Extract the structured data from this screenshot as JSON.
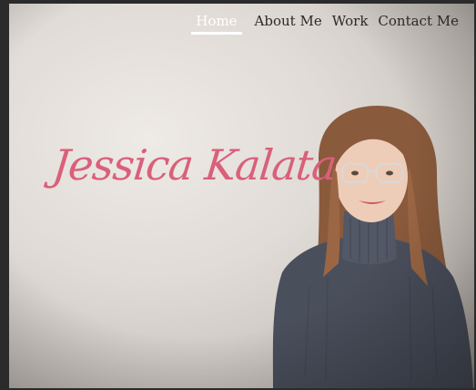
{
  "nav": {
    "items": [
      {
        "label": "Home",
        "active": true
      },
      {
        "label": "About Me",
        "active": false
      },
      {
        "label": "Work",
        "active": false
      },
      {
        "label": "Contact Me",
        "active": false
      }
    ]
  },
  "hero": {
    "name": "Jessica Kalata",
    "name_color": "#d9607a"
  }
}
